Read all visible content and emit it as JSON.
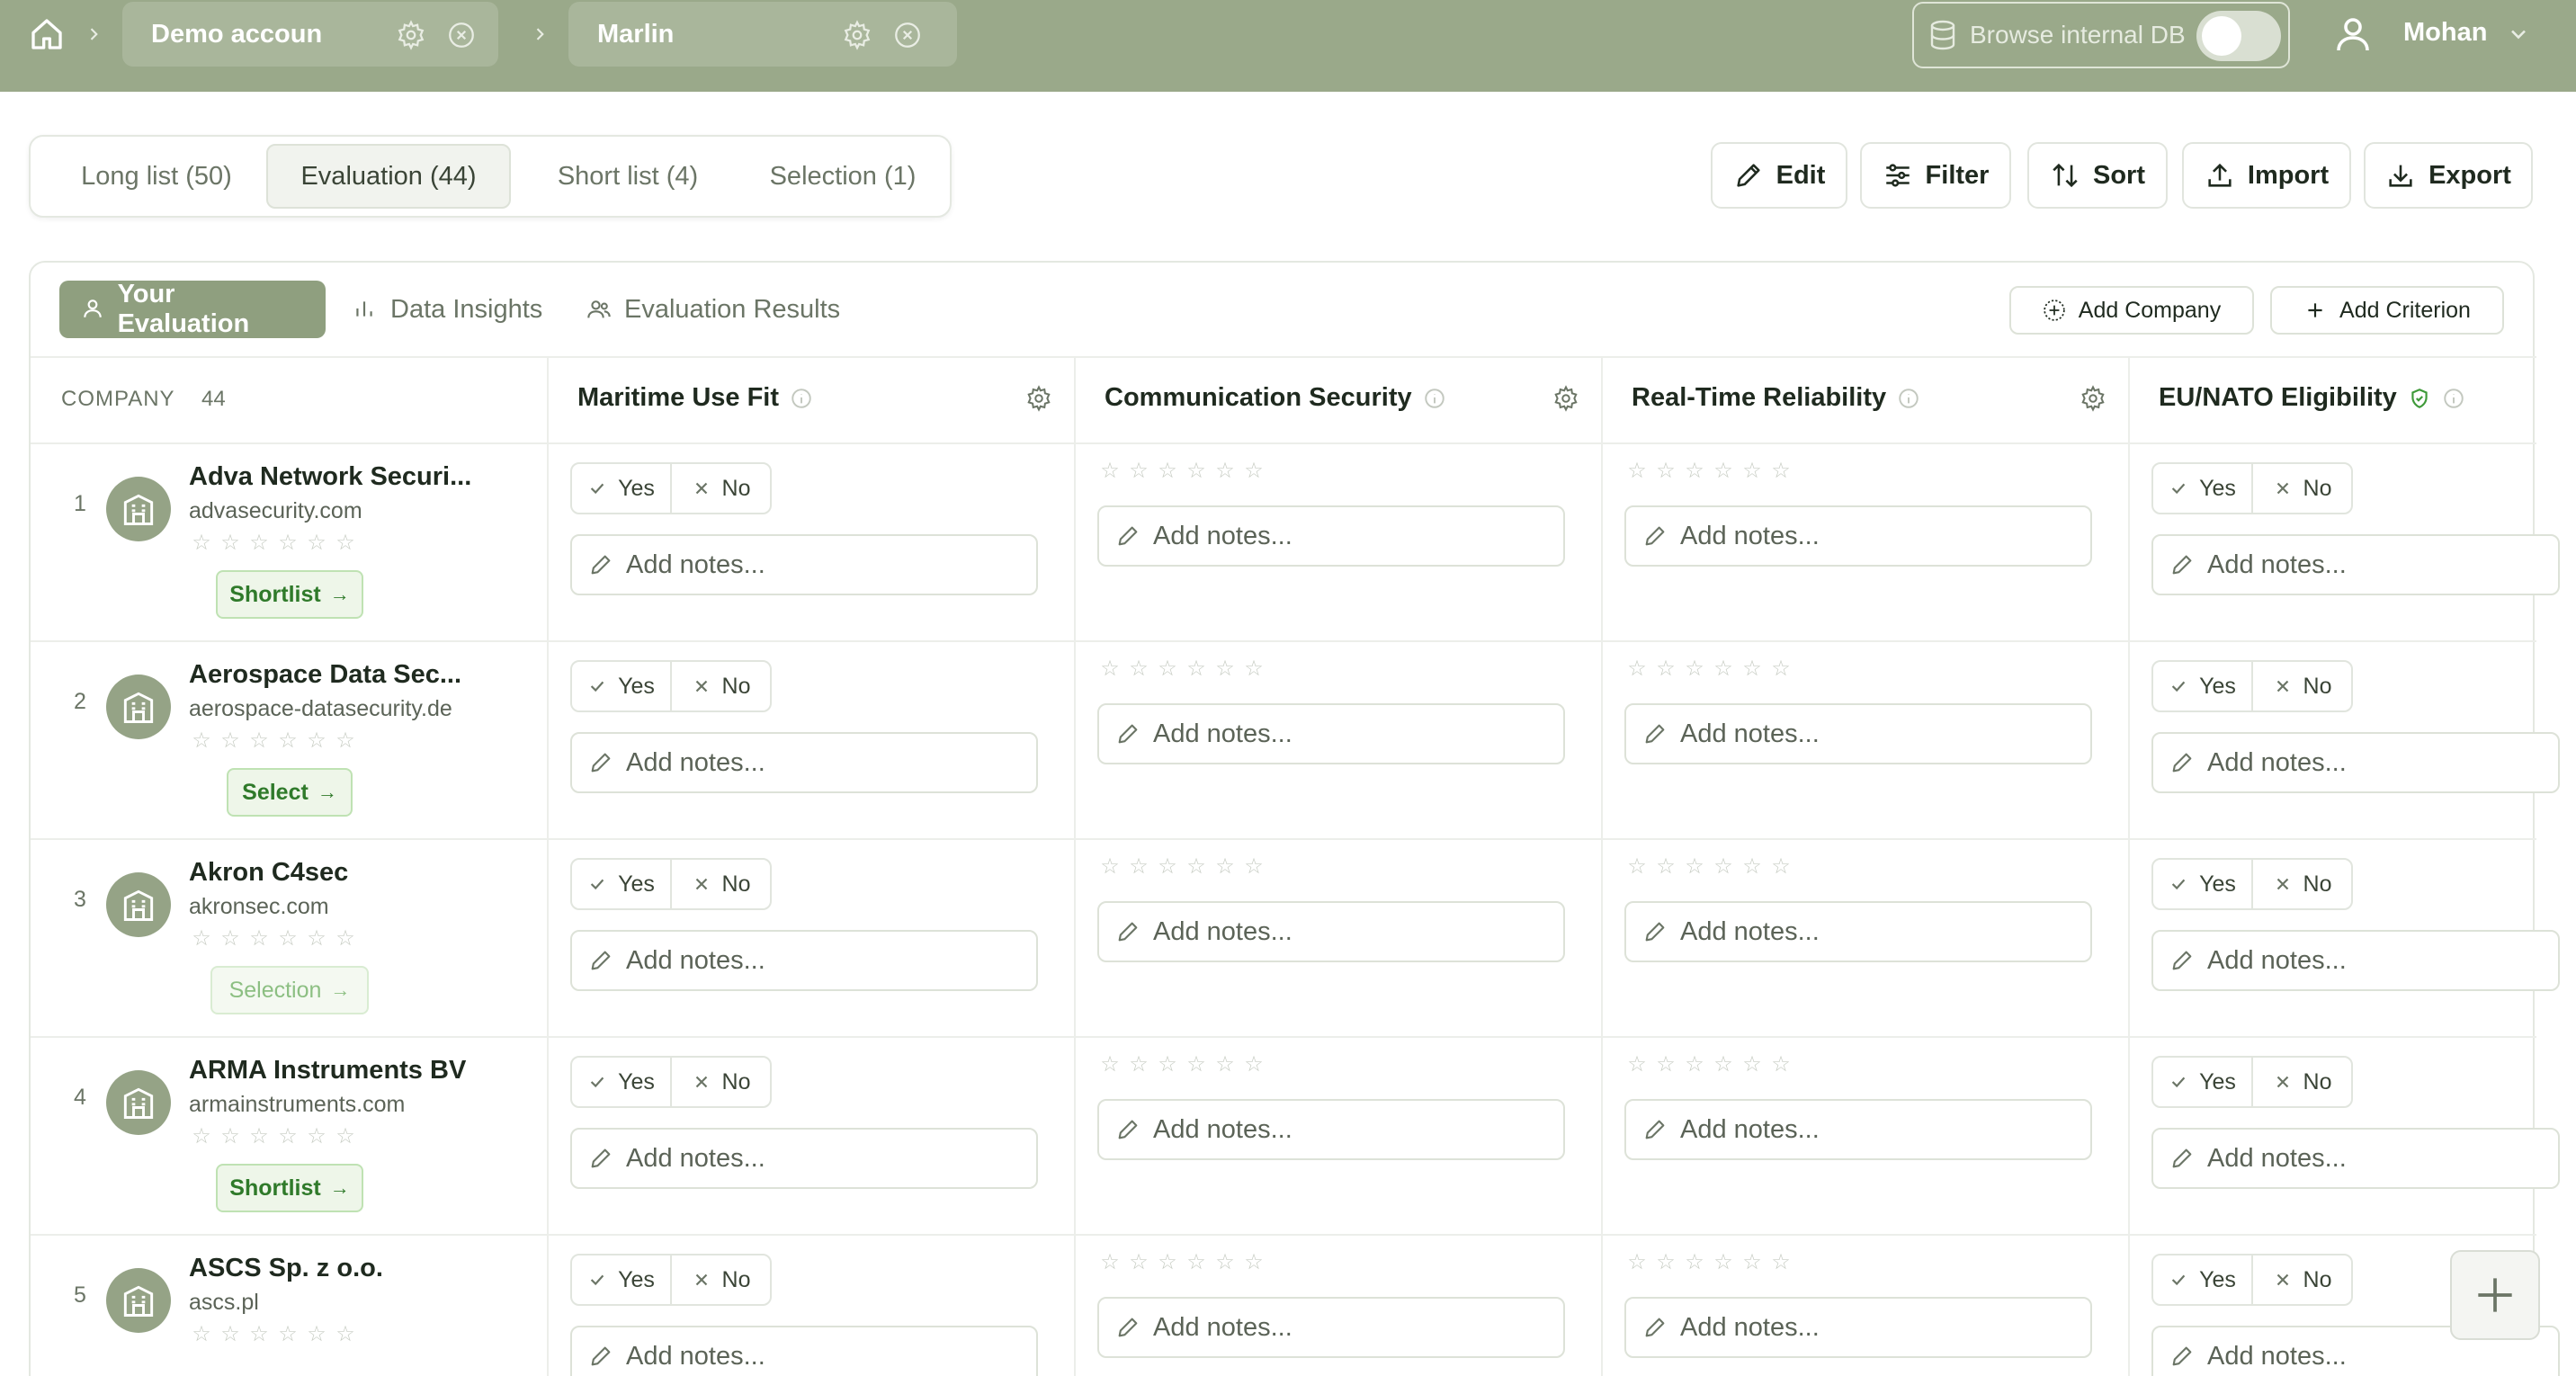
{
  "topbar": {
    "breadcrumbs": [
      {
        "label": "Demo accoun"
      },
      {
        "label": "Marlin"
      }
    ],
    "browse_label": "Browse internal DB",
    "browse_enabled": false,
    "user_name": "Mohan"
  },
  "stage_tabs": [
    {
      "label": "Long list (50)",
      "active": false
    },
    {
      "label": "Evaluation (44)",
      "active": true
    },
    {
      "label": "Short list (4)",
      "active": false
    },
    {
      "label": "Selection (1)",
      "active": false
    }
  ],
  "actions": {
    "edit": "Edit",
    "filter": "Filter",
    "sort": "Sort",
    "import": "Import",
    "export": "Export"
  },
  "sub_tabs": [
    {
      "label": "Your Evaluation",
      "active": true
    },
    {
      "label": "Data Insights",
      "active": false
    },
    {
      "label": "Evaluation Results",
      "active": false
    }
  ],
  "panel_actions": {
    "add_company": "Add Company",
    "add_criterion": "Add Criterion"
  },
  "table": {
    "company_header": "COMPANY",
    "company_count": "44",
    "criteria": [
      {
        "name": "Maritime Use Fit",
        "kind": "yesno"
      },
      {
        "name": "Communication Security",
        "kind": "stars"
      },
      {
        "name": "Real-Time Reliability",
        "kind": "stars"
      },
      {
        "name": "EU/NATO Eligibility",
        "kind": "yesno"
      }
    ],
    "yes_label": "Yes",
    "no_label": "No",
    "notes_placeholder": "Add notes...",
    "rows": [
      {
        "index": "1",
        "name": "Adva Network Securi...",
        "domain": "advasecurity.com",
        "stage": "Shortlist",
        "rating": 0
      },
      {
        "index": "2",
        "name": "Aerospace Data Sec...",
        "domain": "aerospace-datasecurity.de",
        "stage": "Select",
        "rating": 0
      },
      {
        "index": "3",
        "name": "Akron C4sec",
        "domain": "akronsec.com",
        "stage": "Selection",
        "rating": 0
      },
      {
        "index": "4",
        "name": "ARMA Instruments BV",
        "domain": "armainstruments.com",
        "stage": "Shortlist",
        "rating": 0
      },
      {
        "index": "5",
        "name": "ASCS Sp. z o.o.",
        "domain": "ascs.pl",
        "stage": "",
        "rating": 0
      }
    ]
  },
  "colors": {
    "topbar": "#9aa98a",
    "accent": "#8f9f7f",
    "stage_green": "#2f7a2a"
  }
}
